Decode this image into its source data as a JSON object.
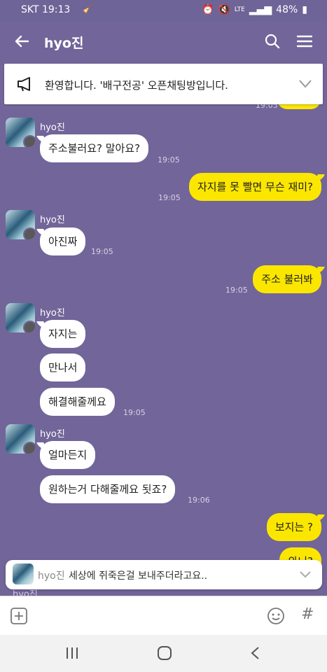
{
  "status": {
    "carrier_time": "SKT 19:13",
    "battery": "48%"
  },
  "header": {
    "title": "hyo진"
  },
  "notice": {
    "text": "환영합니다. '배구전공' 오픈채팅방입니다."
  },
  "notice_peek_time": "19:05",
  "messages": [
    {
      "sender": "hyo진",
      "bubbles": [
        "주소불러요? 말아요?"
      ],
      "time": "19:05"
    },
    {
      "me": true,
      "text": "자지를 못 빨면 무슨 재미?",
      "time": "19:05"
    },
    {
      "sender": "hyo진",
      "bubbles": [
        "아진짜"
      ],
      "time": "19:05"
    },
    {
      "me": true,
      "text": "주소 불러봐",
      "time": "19:05"
    },
    {
      "sender": "hyo진",
      "bubbles": [
        "자지는",
        "만나서",
        "해결해줄께요"
      ],
      "time": "19:05"
    },
    {
      "sender": "hyo진",
      "bubbles": [
        "얼마든지",
        "원하는거 다해줄께요 됫죠?"
      ],
      "time": "19:06"
    },
    {
      "me": true,
      "text": "보지는 ?"
    },
    {
      "me": true,
      "text": "와니?"
    }
  ],
  "preview": {
    "sender": "hyo진",
    "text": "세상에 쥐죽은걸 보내주더라고요..",
    "behind_name": "hyo진"
  },
  "input": {
    "placeholder": ""
  }
}
